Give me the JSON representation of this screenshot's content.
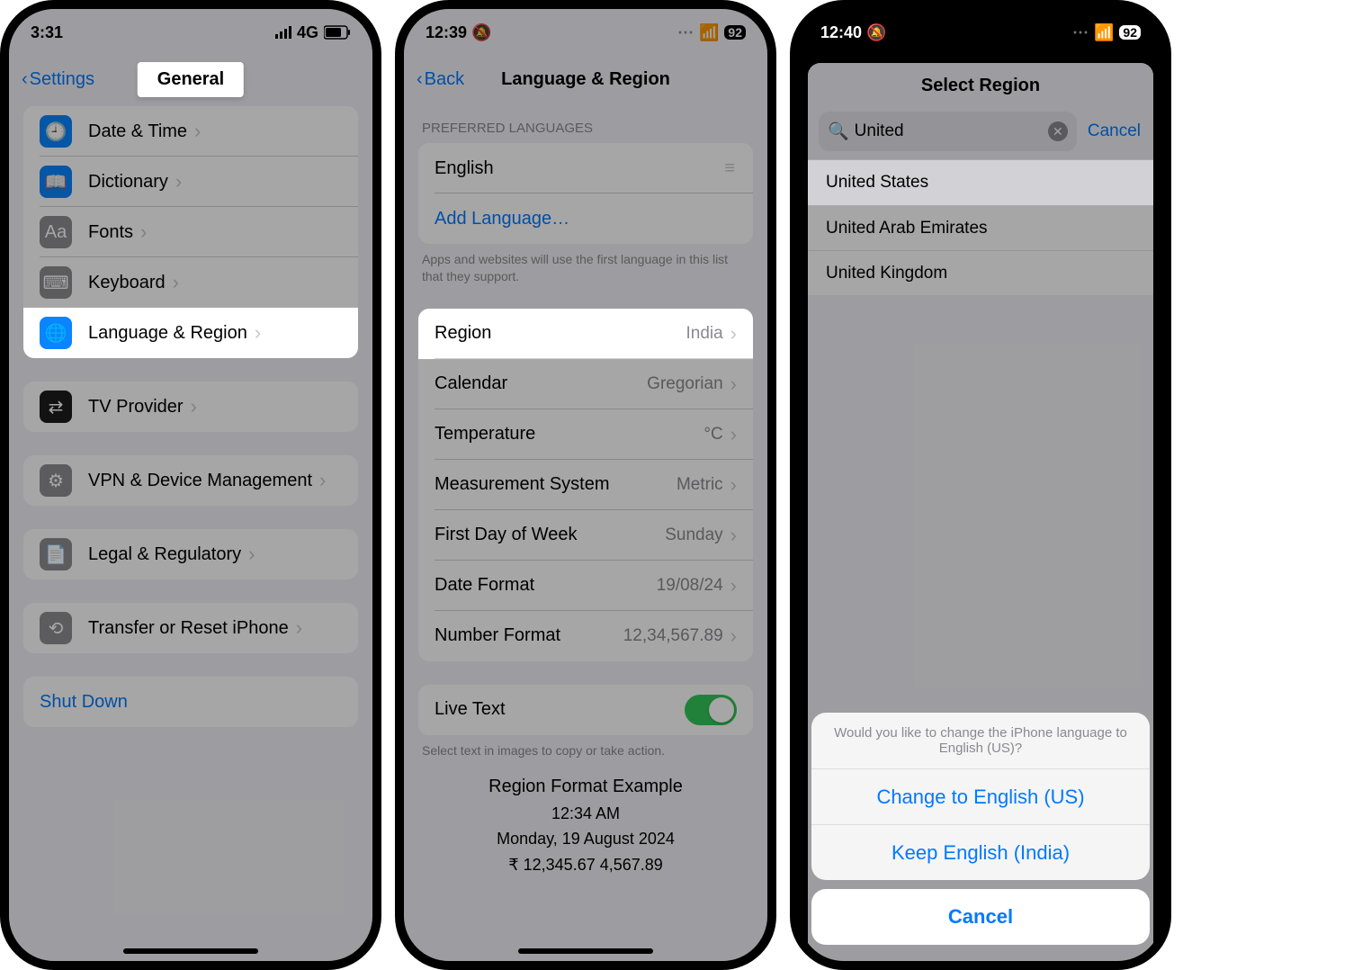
{
  "screen1": {
    "status": {
      "time": "3:31",
      "net": "4G"
    },
    "nav": {
      "back": "Settings",
      "title": "General"
    },
    "items": {
      "date_time": "Date & Time",
      "dictionary": "Dictionary",
      "fonts": "Fonts",
      "keyboard": "Keyboard",
      "lang_region": "Language & Region",
      "tv": "TV Provider",
      "vpn": "VPN & Device Management",
      "legal": "Legal & Regulatory",
      "transfer": "Transfer or Reset iPhone",
      "shutdown": "Shut Down"
    }
  },
  "screen2": {
    "status": {
      "time": "12:39",
      "batt": "92"
    },
    "nav": {
      "back": "Back",
      "title": "Language & Region"
    },
    "section_pref": "PREFERRED LANGUAGES",
    "lang": "English",
    "add_lang": "Add Language…",
    "lang_note": "Apps and websites will use the first language in this list that they support.",
    "rows": {
      "region": {
        "label": "Region",
        "value": "India"
      },
      "calendar": {
        "label": "Calendar",
        "value": "Gregorian"
      },
      "temperature": {
        "label": "Temperature",
        "value": "°C"
      },
      "measurement": {
        "label": "Measurement System",
        "value": "Metric"
      },
      "first_day": {
        "label": "First Day of Week",
        "value": "Sunday"
      },
      "date_format": {
        "label": "Date Format",
        "value": "19/08/24"
      },
      "num_format": {
        "label": "Number Format",
        "value": "12,34,567.89"
      }
    },
    "live_text": "Live Text",
    "live_text_note": "Select text in images to copy or take action.",
    "example": {
      "title": "Region Format Example",
      "l1": "12:34 AM",
      "l2": "Monday, 19 August 2024",
      "l3": "₹ 12,345.67   4,567.89"
    }
  },
  "screen3": {
    "status": {
      "time": "12:40",
      "batt": "92"
    },
    "sheet_title": "Select Region",
    "search_text": "United",
    "cancel": "Cancel",
    "results": [
      "United States",
      "United Arab Emirates",
      "United Kingdom"
    ],
    "action": {
      "msg": "Would you like to change the iPhone language to English (US)?",
      "opt1": "Change to English (US)",
      "opt2": "Keep English (India)",
      "cancel": "Cancel"
    }
  }
}
